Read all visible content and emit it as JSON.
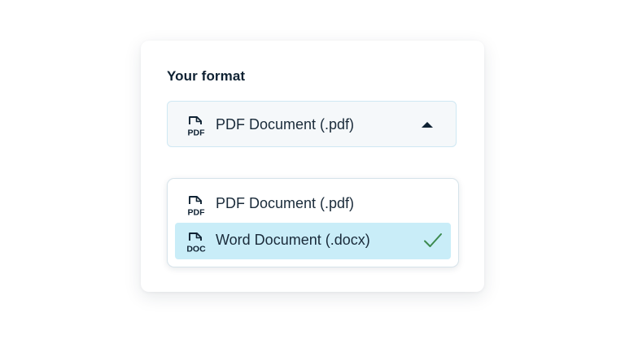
{
  "form": {
    "label": "Your format",
    "selected_value": "PDF Document (.pdf)",
    "selected_icon": "pdf-file-icon"
  },
  "dropdown": {
    "options": [
      {
        "label": "PDF Document (.pdf)",
        "icon_text": "PDF",
        "icon": "pdf-file-icon",
        "selected": false
      },
      {
        "label": "Word Document (.docx)",
        "icon_text": "DOC",
        "icon": "doc-file-icon",
        "selected": true
      }
    ]
  },
  "colors": {
    "accent_highlight": "#c9edf8",
    "check_mark": "#3c8a4e",
    "text_dark": "#0f2233"
  }
}
